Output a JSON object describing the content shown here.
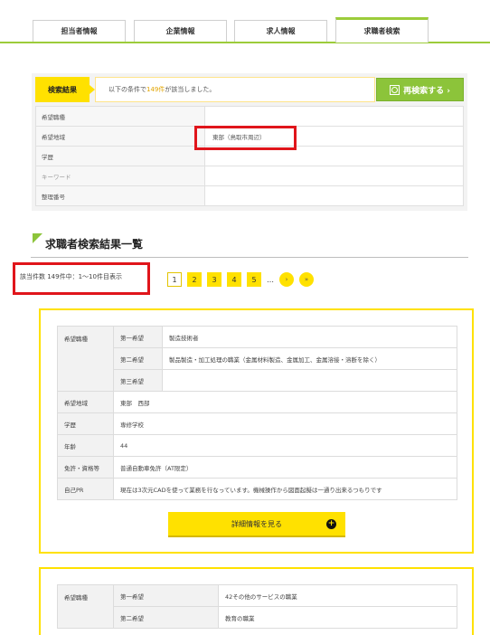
{
  "tabs": [
    {
      "label": "担当者情報"
    },
    {
      "label": "企業情報"
    },
    {
      "label": "求人情報"
    },
    {
      "label": "求職者検索"
    }
  ],
  "search_result": {
    "label": "検索結果",
    "text_before": "以下の条件で",
    "count": "149件",
    "text_after": "が該当しました。",
    "research_button": "再検索する ›",
    "conditions": [
      {
        "key": "希望職種",
        "value": ""
      },
      {
        "key": "希望地域",
        "value": "東部（鳥取市周辺）"
      },
      {
        "key": "学歴",
        "value": ""
      },
      {
        "key": "キーワード",
        "value": ""
      },
      {
        "key": "整理番号",
        "value": ""
      }
    ]
  },
  "section": {
    "title": "求職者検索結果一覧"
  },
  "pagination": {
    "summary": "該当件数 149件中：1〜10件目表示",
    "pages": [
      "1",
      "2",
      "3",
      "4",
      "5"
    ],
    "ellipsis": "…",
    "next": "›",
    "last": "»"
  },
  "results": [
    {
      "job_key": "希望職種",
      "jobs": [
        {
          "rank": "第一希望",
          "value": "製造技術者"
        },
        {
          "rank": "第二希望",
          "value": "製品製造・加工処理の職業（金属材料製造、金属加工、金属溶接・溶断を除く）"
        },
        {
          "rank": "第三希望",
          "value": ""
        }
      ],
      "rows": [
        {
          "key": "希望地域",
          "value": "東部　西部"
        },
        {
          "key": "学歴",
          "value": "専修学校"
        },
        {
          "key": "年齢",
          "value": "44"
        },
        {
          "key": "免許・資格等",
          "value": "普通自動車免許（AT限定）"
        },
        {
          "key": "自己PR",
          "value": "現在は3次元CADを使って業務を行なっています。機械操作から図面起擬は一通り出来るつもりです"
        }
      ],
      "detail_button": "詳細情報を見る"
    },
    {
      "job_key": "希望職種",
      "jobs": [
        {
          "rank": "第一希望",
          "value": "42その他のサービスの職業"
        },
        {
          "rank": "第二希望",
          "value": "教育の職業"
        }
      ]
    }
  ],
  "colors": {
    "accent_green": "#8cc43a",
    "accent_yellow": "#ffe100",
    "highlight_red": "#e0151b"
  }
}
